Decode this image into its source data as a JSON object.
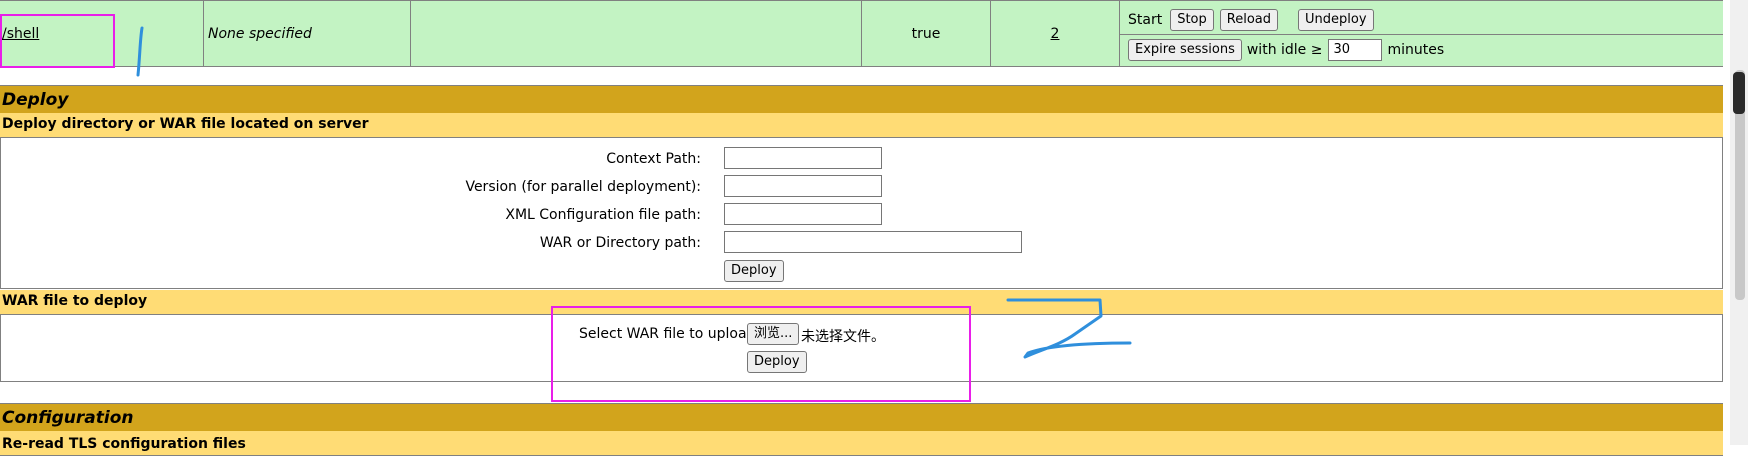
{
  "app_row": {
    "path": "/shell",
    "display_name": "None specified",
    "running": "true",
    "sessions": "2",
    "commands": {
      "start_label": "Start",
      "stop_label": "Stop",
      "reload_label": "Reload",
      "undeploy_label": "Undeploy",
      "expire_label": "Expire sessions",
      "with_idle_label": "with idle ≥",
      "idle_value": "30",
      "minutes_label": "minutes"
    }
  },
  "deploy": {
    "title": "Deploy",
    "server_section": {
      "title": "Deploy directory or WAR file located on server",
      "context_path_label": "Context Path:",
      "version_label": "Version (for parallel deployment):",
      "xml_config_label": "XML Configuration file path:",
      "war_dir_label": "WAR or Directory path:",
      "deploy_button": "Deploy"
    },
    "upload_section": {
      "title": "WAR file to deploy",
      "select_label": "Select WAR file to upload",
      "browse_button": "浏览...",
      "no_file_text": "未选择文件。",
      "deploy_button": "Deploy"
    }
  },
  "configuration": {
    "title": "Configuration",
    "sub_title": "Re-read TLS configuration files"
  },
  "annotation_colors": {
    "highlight": "#e91ee9",
    "pen": "#2f8fdc"
  }
}
